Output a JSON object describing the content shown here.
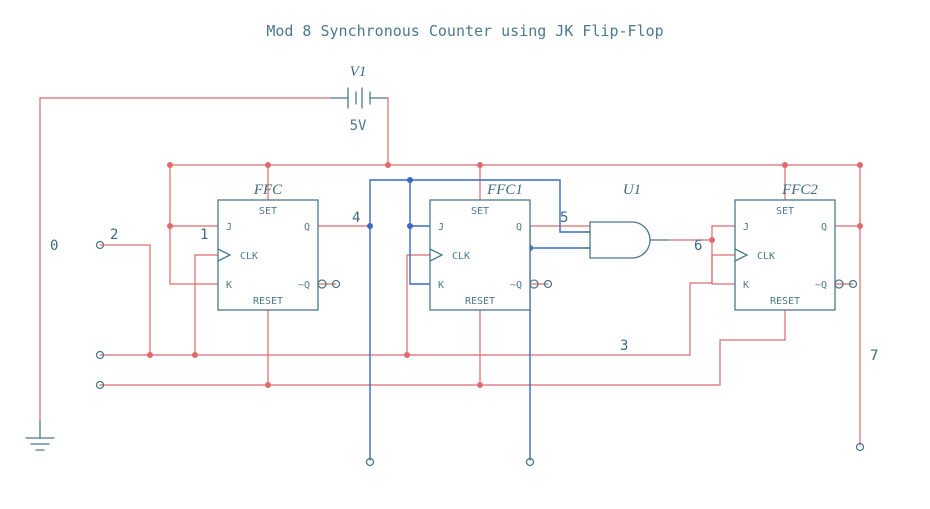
{
  "title": "Mod 8 Synchronous Counter using JK Flip-Flop",
  "voltage_source": {
    "name": "V1",
    "value": "5V"
  },
  "gate": {
    "name": "U1"
  },
  "flipflops": [
    {
      "name": "FFC",
      "pins": {
        "set": "SET",
        "reset": "RESET",
        "j": "J",
        "k": "K",
        "clk": "CLK",
        "q": "Q",
        "qn": "~Q"
      }
    },
    {
      "name": "FFC1",
      "pins": {
        "set": "SET",
        "reset": "RESET",
        "j": "J",
        "k": "K",
        "clk": "CLK",
        "q": "Q",
        "qn": "~Q"
      }
    },
    {
      "name": "FFC2",
      "pins": {
        "set": "SET",
        "reset": "RESET",
        "j": "J",
        "k": "K",
        "clk": "CLK",
        "q": "Q",
        "qn": "~Q"
      }
    }
  ],
  "nets": {
    "n0": "0",
    "n1": "1",
    "n2": "2",
    "n3": "3",
    "n4": "4",
    "n5": "5",
    "n6": "6",
    "n7": "7"
  },
  "chart_data": {
    "type": "schematic",
    "description": "Mod-8 synchronous up-counter built from three JK flip-flops and one 2-input AND gate",
    "power": {
      "source": "V1",
      "voltage_volts": 5
    },
    "components": [
      {
        "ref": "V1",
        "type": "dc-source",
        "value": "5V"
      },
      {
        "ref": "FFC",
        "type": "jk-flip-flop"
      },
      {
        "ref": "FFC1",
        "type": "jk-flip-flop"
      },
      {
        "ref": "FFC2",
        "type": "jk-flip-flop"
      },
      {
        "ref": "U1",
        "type": "and-gate-2"
      }
    ],
    "net_annotations": [
      "0",
      "1",
      "2",
      "3",
      "4",
      "5",
      "6",
      "7"
    ]
  }
}
